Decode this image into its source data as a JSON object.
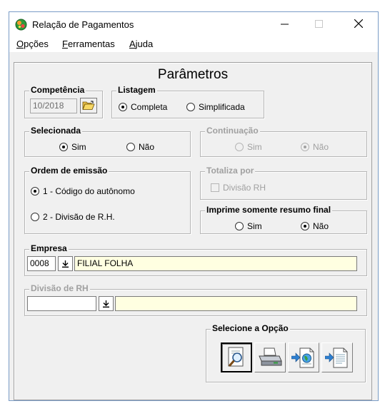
{
  "window": {
    "title": "Relação de Pagamentos",
    "icon": "app-green-orb-icon"
  },
  "menu": [
    "Opções",
    "Ferramentas",
    "Ajuda"
  ],
  "heading": "Parâmetros",
  "competencia": {
    "label": "Competência",
    "value": "10/2018",
    "icon": "folder-open-icon"
  },
  "listagem": {
    "label": "Listagem",
    "options": [
      {
        "label": "Completa",
        "checked": true
      },
      {
        "label": "Simplificada",
        "checked": false
      }
    ]
  },
  "selecionada": {
    "label": "Selecionada",
    "options": [
      {
        "label": "Sim",
        "checked": true
      },
      {
        "label": "Não",
        "checked": false
      }
    ]
  },
  "continuacao": {
    "label": "Continuação",
    "disabled": true,
    "options": [
      {
        "label": "Sim",
        "checked": false
      },
      {
        "label": "Não",
        "checked": true
      }
    ]
  },
  "ordem": {
    "label": "Ordem de emissão",
    "options": [
      {
        "label": "1 - Código do autônomo",
        "checked": true
      },
      {
        "label": "2 - Divisão de R.H.",
        "checked": false
      }
    ]
  },
  "totaliza": {
    "label": "Totaliza por",
    "disabled": true,
    "checkbox": {
      "label": "Divisão RH",
      "checked": false
    }
  },
  "resumo": {
    "label": "Imprime somente resumo final",
    "options": [
      {
        "label": "Sim",
        "checked": false
      },
      {
        "label": "Não",
        "checked": true
      }
    ]
  },
  "empresa": {
    "label": "Empresa",
    "code": "0008",
    "name": "FILIAL FOLHA"
  },
  "divisao": {
    "label": "Divisão de RH",
    "disabled": true,
    "code": "",
    "name": ""
  },
  "selecione": {
    "label": "Selecione a Opção",
    "buttons": [
      {
        "icon": "preview-magnifier-icon",
        "active": true
      },
      {
        "icon": "printer-icon",
        "active": false
      },
      {
        "icon": "export-globe-document-icon",
        "active": false
      },
      {
        "icon": "export-document-icon",
        "active": false
      }
    ]
  },
  "colors": {
    "field_yellow": "#ffffe1",
    "window_bg": "#f0f0f0",
    "disabled_text": "#a0a0a0"
  }
}
